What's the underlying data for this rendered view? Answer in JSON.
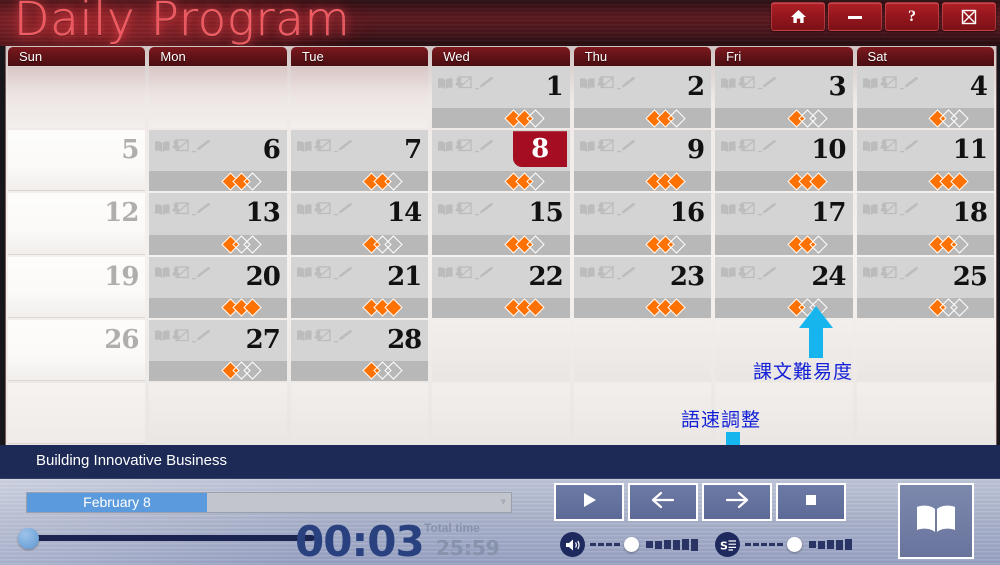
{
  "window": {
    "app_title": "Daily Program",
    "controls": [
      {
        "name": "home-button",
        "icon": "home-icon"
      },
      {
        "name": "minimize-button",
        "icon": "minimize-icon"
      },
      {
        "name": "help-button",
        "icon": "question-mark-icon",
        "label": "?"
      },
      {
        "name": "close-button",
        "icon": "close-icon"
      }
    ]
  },
  "calendar": {
    "weekday_headers": [
      "Sun",
      "Mon",
      "Tue",
      "Wed",
      "Thu",
      "Fri",
      "Sat"
    ],
    "selected_day": 8,
    "cell_icons": [
      "book-icon",
      "video-lesson-icon",
      "pencil-icon"
    ],
    "weeks": [
      [
        {
          "kind": "blank"
        },
        {
          "kind": "blank"
        },
        {
          "kind": "blank"
        },
        {
          "kind": "day",
          "num": "1",
          "difficulty": 2
        },
        {
          "kind": "day",
          "num": "2",
          "difficulty": 2
        },
        {
          "kind": "day",
          "num": "3",
          "difficulty": 1
        },
        {
          "kind": "day",
          "num": "4",
          "difficulty": 1
        }
      ],
      [
        {
          "kind": "sun",
          "num": "5"
        },
        {
          "kind": "day",
          "num": "6",
          "difficulty": 2
        },
        {
          "kind": "day",
          "num": "7",
          "difficulty": 2
        },
        {
          "kind": "day",
          "num": "8",
          "difficulty": 2,
          "selected": true
        },
        {
          "kind": "day",
          "num": "9",
          "difficulty": 3
        },
        {
          "kind": "day",
          "num": "10",
          "difficulty": 3
        },
        {
          "kind": "day",
          "num": "11",
          "difficulty": 3
        }
      ],
      [
        {
          "kind": "sun",
          "num": "12"
        },
        {
          "kind": "day",
          "num": "13",
          "difficulty": 1
        },
        {
          "kind": "day",
          "num": "14",
          "difficulty": 1
        },
        {
          "kind": "day",
          "num": "15",
          "difficulty": 2
        },
        {
          "kind": "day",
          "num": "16",
          "difficulty": 2
        },
        {
          "kind": "day",
          "num": "17",
          "difficulty": 2
        },
        {
          "kind": "day",
          "num": "18",
          "difficulty": 2
        }
      ],
      [
        {
          "kind": "sun",
          "num": "19"
        },
        {
          "kind": "day",
          "num": "20",
          "difficulty": 3
        },
        {
          "kind": "day",
          "num": "21",
          "difficulty": 3
        },
        {
          "kind": "day",
          "num": "22",
          "difficulty": 3
        },
        {
          "kind": "day",
          "num": "23",
          "difficulty": 3
        },
        {
          "kind": "day",
          "num": "24",
          "difficulty": 1
        },
        {
          "kind": "day",
          "num": "25",
          "difficulty": 1
        }
      ],
      [
        {
          "kind": "sun",
          "num": "26"
        },
        {
          "kind": "day",
          "num": "27",
          "difficulty": 1
        },
        {
          "kind": "day",
          "num": "28",
          "difficulty": 1
        },
        {
          "kind": "off"
        },
        {
          "kind": "off"
        },
        {
          "kind": "off"
        },
        {
          "kind": "off"
        }
      ],
      [
        {
          "kind": "sun-empty"
        },
        {
          "kind": "off"
        },
        {
          "kind": "off"
        },
        {
          "kind": "off"
        },
        {
          "kind": "off"
        },
        {
          "kind": "off"
        },
        {
          "kind": "off"
        }
      ]
    ]
  },
  "annotations": [
    {
      "name": "difficulty-annotation",
      "text": "課文難易度",
      "color": "#1421d6",
      "arrow": "up"
    },
    {
      "name": "speed-annotation",
      "text": "語速調整",
      "color": "#1421d6",
      "arrow": "down"
    }
  ],
  "player": {
    "lesson_title": "Building Innovative Business",
    "date_select_value": "February 8",
    "current_time": "00:03",
    "total_time_label": "Total time",
    "total_time": "25:59",
    "seek_percent": 6,
    "transport": [
      {
        "name": "play-button",
        "icon": "play-icon"
      },
      {
        "name": "previous-button",
        "icon": "arrow-left-icon"
      },
      {
        "name": "next-button",
        "icon": "arrow-right-icon"
      },
      {
        "name": "stop-button",
        "icon": "stop-icon"
      }
    ],
    "volume": {
      "name": "volume-slider",
      "icon": "volume-icon",
      "value": 40
    },
    "speed": {
      "name": "speed-slider",
      "icon": "speed-icon",
      "value": 50
    },
    "book_button": {
      "name": "open-book-button",
      "icon": "open-book-icon"
    }
  },
  "colors": {
    "accent_red": "#a50d22",
    "title_glow": "#f2545b",
    "diamond_on": "#ff7100",
    "annotation_blue": "#1421d6",
    "arrow_cyan": "#17b5ee",
    "player_navy": "#1d2a56"
  }
}
